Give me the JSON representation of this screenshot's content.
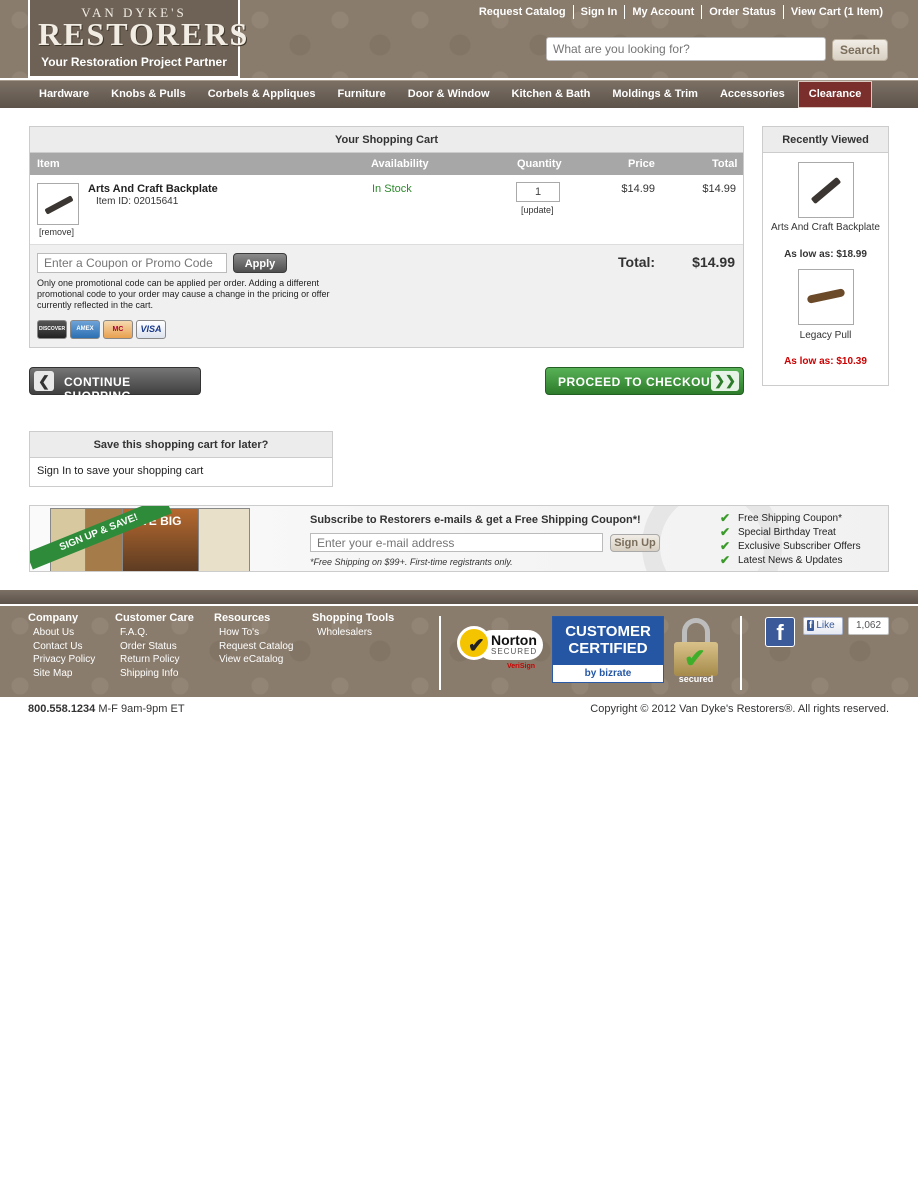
{
  "logo": {
    "small": "VAN DYKE'S",
    "big": "RESTORERS",
    "tagline": "Your Restoration Project Partner"
  },
  "top_links": [
    "Request Catalog",
    "Sign In",
    "My Account",
    "Order Status",
    "View Cart (1 Item)"
  ],
  "search": {
    "placeholder": "What are you looking for?",
    "button": "Search"
  },
  "nav": [
    "Hardware",
    "Knobs & Pulls",
    "Corbels & Appliques",
    "Furniture",
    "Door & Window",
    "Kitchen & Bath",
    "Moldings & Trim",
    "Accessories",
    "Clearance"
  ],
  "cart": {
    "title": "Your Shopping Cart",
    "columns": {
      "item": "Item",
      "availability": "Availability",
      "quantity": "Quantity",
      "price": "Price",
      "total": "Total"
    },
    "item": {
      "name": "Arts And Craft Backplate",
      "item_id": "Item ID: 02015641",
      "remove": "[remove]",
      "availability": "In Stock",
      "quantity": "1",
      "update": "[update]",
      "price": "$14.99",
      "total": "$14.99"
    },
    "coupon": {
      "placeholder": "Enter a Coupon or Promo Code",
      "apply": "Apply",
      "note": "Only one promotional code can be applied per order. Adding a different promotional code to your order may cause a change in the pricing or offer currently reflected in the cart."
    },
    "total_label": "Total:",
    "total_value": "$14.99",
    "cards": [
      "DISCOVER",
      "AMEX",
      "MC",
      "VISA"
    ]
  },
  "buttons": {
    "continue": "CONTINUE SHOPPING",
    "checkout": "PROCEED TO CHECKOUT"
  },
  "recently_viewed": {
    "title": "Recently Viewed",
    "items": [
      {
        "name": "Arts And Craft Backplate",
        "price": "As low as: $18.99"
      },
      {
        "name": "Legacy Pull",
        "price": "As low as: $10.39"
      }
    ]
  },
  "save_cart": {
    "title": "Save this shopping cart for later?",
    "text": "Sign In to save your shopping cart"
  },
  "subscribe": {
    "ribbon": "SIGN UP & SAVE!",
    "save_big": "SAVE BIG",
    "title": "Subscribe to Restorers e-mails & get a Free Shipping Coupon*!",
    "placeholder": "Enter your e-mail address",
    "button": "Sign Up",
    "note": "*Free Shipping on $99+. First-time registrants only.",
    "benefits": [
      "Free Shipping Coupon*",
      "Special Birthday Treat",
      "Exclusive Subscriber Offers",
      "Latest News & Updates"
    ]
  },
  "footer": {
    "columns": [
      {
        "heading": "Company",
        "links": [
          "About Us",
          "Contact Us",
          "Privacy Policy",
          "Site Map"
        ]
      },
      {
        "heading": "Customer Care",
        "links": [
          "F.A.Q.",
          "Order Status",
          "Return Policy",
          "Shipping Info"
        ]
      },
      {
        "heading": "Resources",
        "links": [
          "How To's",
          "Request Catalog",
          "View eCatalog"
        ]
      },
      {
        "heading": "Shopping Tools",
        "links": [
          "Wholesalers"
        ]
      }
    ],
    "norton": {
      "name": "Norton",
      "secured": "SECURED",
      "verisign": "VeriSign"
    },
    "bizrate": {
      "line1": "CUSTOMER",
      "line2": "CERTIFIED",
      "by": "by bizrate"
    },
    "secured_label": "secured",
    "fb_like": "Like",
    "fb_count": "1,062",
    "phone": "800.558.1234",
    "hours": "M-F 9am-9pm ET",
    "copyright": "Copyright © 2012 Van Dyke's Restorers®. All rights reserved."
  }
}
